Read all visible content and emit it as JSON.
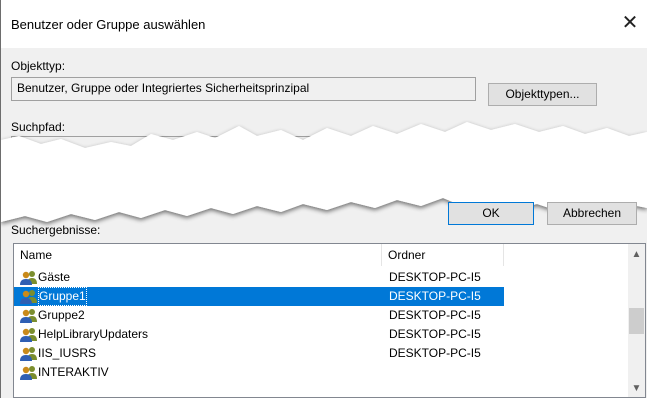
{
  "dialog": {
    "title": "Benutzer oder Gruppe auswählen",
    "close_icon": "close-icon"
  },
  "object_type": {
    "label": "Objekttyp:",
    "value": "Benutzer, Gruppe oder Integriertes Sicherheitsprinzipal",
    "button": "Objekttypen..."
  },
  "search_path": {
    "label": "Suchpfad:"
  },
  "buttons": {
    "ok": "OK",
    "cancel": "Abbrechen"
  },
  "results": {
    "label": "Suchergebnisse:",
    "columns": [
      "Name",
      "Ordner"
    ],
    "rows": [
      {
        "name": "Gäste",
        "folder": "DESKTOP-PC-I5",
        "icon": "group-icon",
        "selected": false
      },
      {
        "name": "Gruppe1",
        "folder": "DESKTOP-PC-I5",
        "icon": "group-icon",
        "selected": true
      },
      {
        "name": "Gruppe2",
        "folder": "DESKTOP-PC-I5",
        "icon": "group-icon",
        "selected": false
      },
      {
        "name": "HelpLibraryUpdaters",
        "folder": "DESKTOP-PC-I5",
        "icon": "group-icon",
        "selected": false
      },
      {
        "name": "IIS_IUSRS",
        "folder": "DESKTOP-PC-I5",
        "icon": "group-icon",
        "selected": false
      },
      {
        "name": "INTERAKTIV",
        "folder": "",
        "icon": "group-icon",
        "selected": false
      }
    ]
  },
  "colors": {
    "selection": "#0078d7",
    "dialog_bg": "#f0f0f0"
  }
}
